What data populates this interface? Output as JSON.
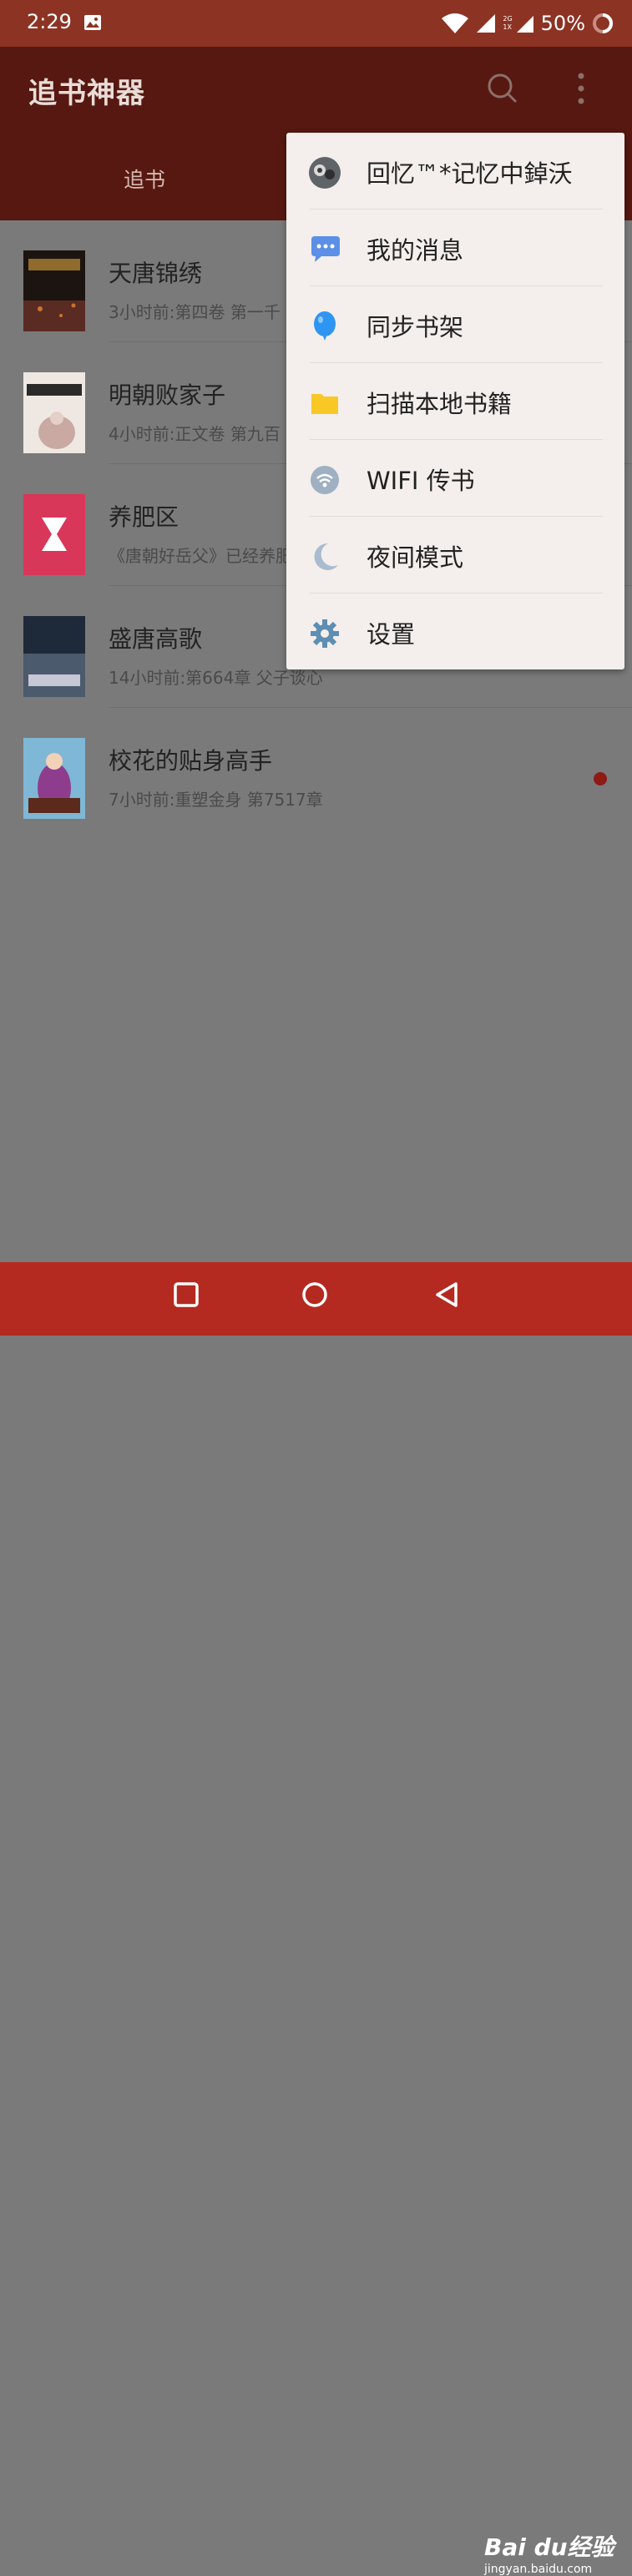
{
  "status_bar": {
    "time": "2:29",
    "net_top": "2G",
    "net_bottom": "1X",
    "battery": "50%"
  },
  "app_bar": {
    "title": "追书神器",
    "tab_label": "追书"
  },
  "books": [
    {
      "title": "天唐锦绣",
      "subtitle": "3小时前:第四卷 第一千",
      "cover_colors": [
        "#1c1410",
        "#5a2b22"
      ]
    },
    {
      "title": "明朝败家子",
      "subtitle": "4小时前:正文卷 第九百",
      "cover_colors": [
        "#efe8e2",
        "#c9a9a2"
      ]
    },
    {
      "title": "养肥区",
      "subtitle": "《唐朝好岳父》已经养肥",
      "cover_colors": [
        "#d9375a",
        "#d9375a"
      ]
    },
    {
      "title": "盛唐高歌",
      "subtitle": "14小时前:第664章 父子谈心",
      "cover_colors": [
        "#1e2a3a",
        "#4c5a6e"
      ]
    },
    {
      "title": "校花的贴身高手",
      "subtitle": "7小时前:重塑金身 第7517章",
      "cover_colors": [
        "#7fb7d6",
        "#8e3d8e"
      ]
    }
  ],
  "menu": {
    "items": [
      {
        "label": "回忆™*记忆中鋽沃",
        "icon": "user-avatar-icon"
      },
      {
        "label": "我的消息",
        "icon": "message-bubble-icon"
      },
      {
        "label": "同步书架",
        "icon": "balloon-icon"
      },
      {
        "label": "扫描本地书籍",
        "icon": "folder-icon"
      },
      {
        "label": "WIFI 传书",
        "icon": "wifi-icon"
      },
      {
        "label": "夜间模式",
        "icon": "moon-icon"
      },
      {
        "label": "设置",
        "icon": "gear-icon"
      }
    ]
  },
  "watermark": {
    "brand": "Bai du经验",
    "url": "jingyan.baidu.com"
  },
  "colors": {
    "status_bar": "#8c3324",
    "app_bar": "#561810",
    "nav_bar": "#b42a20",
    "menu_bg": "#f4efec",
    "unread_dot": "#8e1a14"
  }
}
